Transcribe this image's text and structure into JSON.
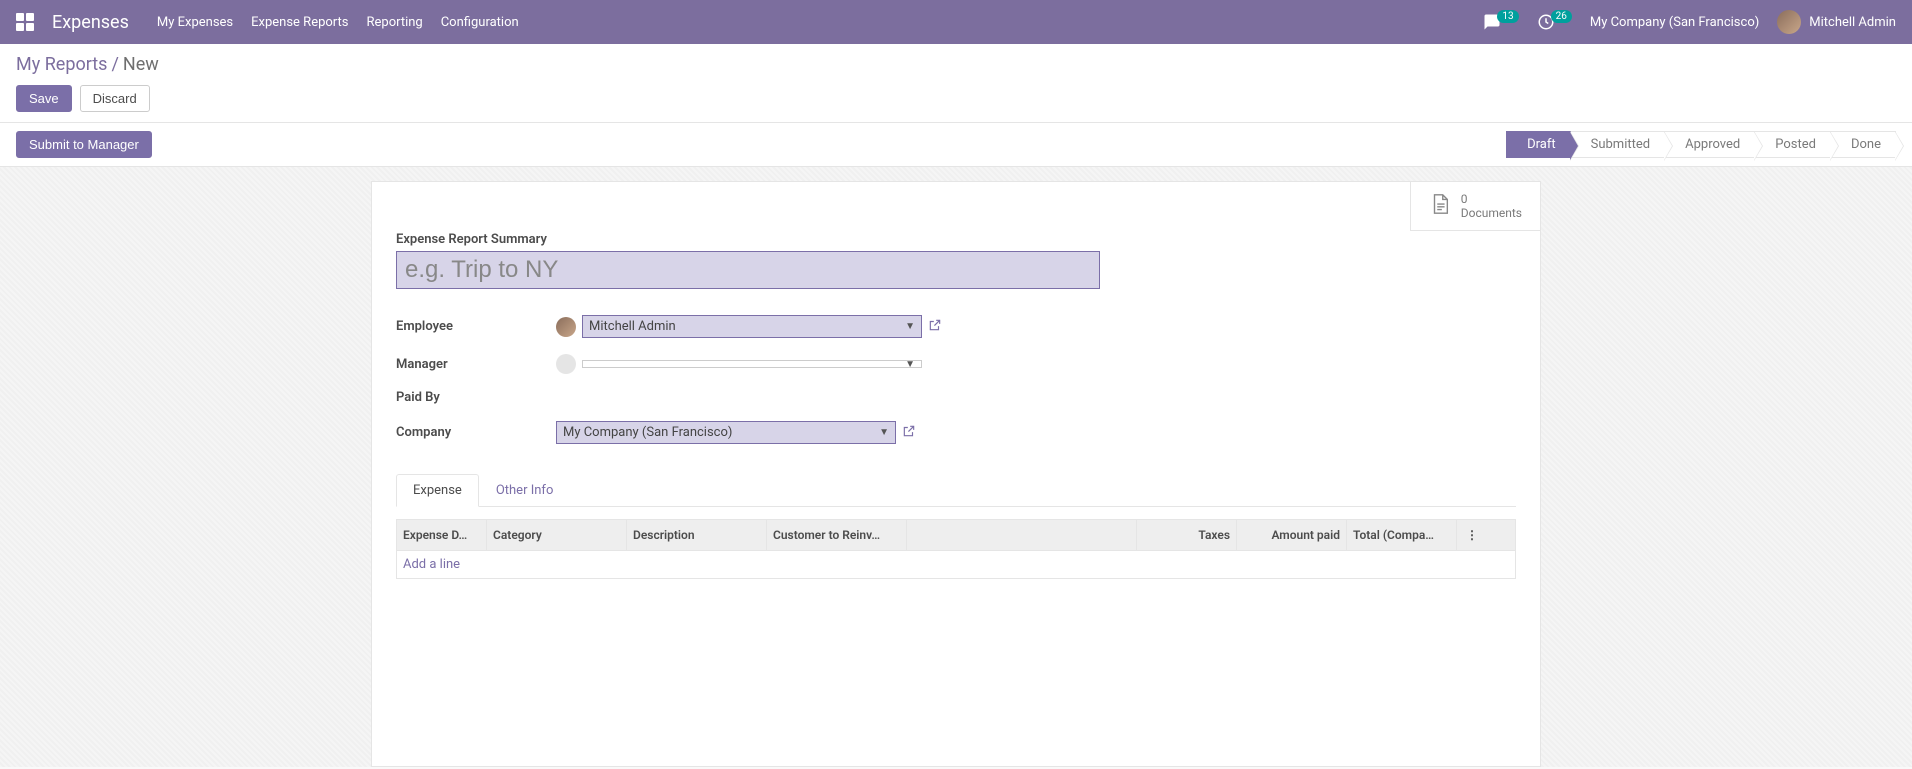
{
  "navbar": {
    "app_title": "Expenses",
    "links": [
      "My Expenses",
      "Expense Reports",
      "Reporting",
      "Configuration"
    ],
    "chat_count": "13",
    "activity_count": "26",
    "company": "My Company (San Francisco)",
    "user": "Mitchell Admin"
  },
  "breadcrumb": {
    "parent": "My Reports",
    "current": "New"
  },
  "buttons": {
    "save": "Save",
    "discard": "Discard",
    "submit": "Submit to Manager"
  },
  "status": {
    "steps": [
      "Draft",
      "Submitted",
      "Approved",
      "Posted",
      "Done"
    ],
    "active_index": 0
  },
  "stat": {
    "count": "0",
    "label": "Documents"
  },
  "form": {
    "summary_label": "Expense Report Summary",
    "summary_placeholder": "e.g. Trip to NY",
    "summary_value": "",
    "employee_label": "Employee",
    "employee_value": "Mitchell Admin",
    "manager_label": "Manager",
    "manager_value": "",
    "paidby_label": "Paid By",
    "company_label": "Company",
    "company_value": "My Company (San Francisco)"
  },
  "tabs": {
    "items": [
      "Expense",
      "Other Info"
    ]
  },
  "table": {
    "headers": {
      "date": "Expense D…",
      "category": "Category",
      "description": "Description",
      "customer": "Customer to Reinv…",
      "blank": "",
      "taxes": "Taxes",
      "amount": "Amount paid",
      "total": "Total (Compa…",
      "menu": "⋮"
    },
    "add_line": "Add a line"
  }
}
